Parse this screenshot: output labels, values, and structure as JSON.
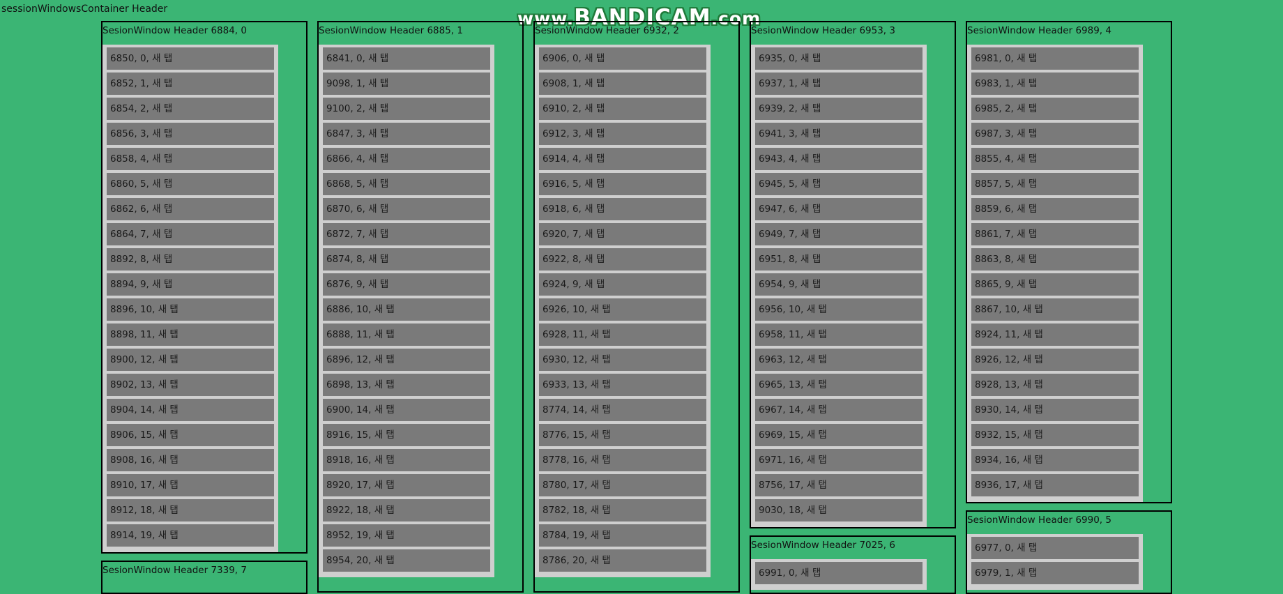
{
  "container": {
    "header": "sessionWindowsContainer Header"
  },
  "watermark": {
    "prefix": "www.",
    "brand": "BANDICAM",
    "suffix": ".com"
  },
  "windows": [
    {
      "header": "SesionWindow Header 6884, 0",
      "tabs": [
        "6850, 0, 새 탭",
        "6852, 1, 새 탭",
        "6854, 2, 새 탭",
        "6856, 3, 새 탭",
        "6858, 4, 새 탭",
        "6860, 5, 새 탭",
        "6862, 6, 새 탭",
        "6864, 7, 새 탭",
        "8892, 8, 새 탭",
        "8894, 9, 새 탭",
        "8896, 10, 새 탭",
        "8898, 11, 새 탭",
        "8900, 12, 새 탭",
        "8902, 13, 새 탭",
        "8904, 14, 새 탭",
        "8906, 15, 새 탭",
        "8908, 16, 새 탭",
        "8910, 17, 새 탭",
        "8912, 18, 새 탭",
        "8914, 19, 새 탭"
      ]
    },
    {
      "header": "SesionWindow Header 6885, 1",
      "tabs": [
        "6841, 0, 새 탭",
        "9098, 1, 새 탭",
        "9100, 2, 새 탭",
        "6847, 3, 새 탭",
        "6866, 4, 새 탭",
        "6868, 5, 새 탭",
        "6870, 6, 새 탭",
        "6872, 7, 새 탭",
        "6874, 8, 새 탭",
        "6876, 9, 새 탭",
        "6886, 10, 새 탭",
        "6888, 11, 새 탭",
        "6896, 12, 새 탭",
        "6898, 13, 새 탭",
        "6900, 14, 새 탭",
        "8916, 15, 새 탭",
        "8918, 16, 새 탭",
        "8920, 17, 새 탭",
        "8922, 18, 새 탭",
        "8952, 19, 새 탭",
        "8954, 20, 새 탭"
      ]
    },
    {
      "header": "SesionWindow Header 6932, 2",
      "tabs": [
        "6906, 0, 새 탭",
        "6908, 1, 새 탭",
        "6910, 2, 새 탭",
        "6912, 3, 새 탭",
        "6914, 4, 새 탭",
        "6916, 5, 새 탭",
        "6918, 6, 새 탭",
        "6920, 7, 새 탭",
        "6922, 8, 새 탭",
        "6924, 9, 새 탭",
        "6926, 10, 새 탭",
        "6928, 11, 새 탭",
        "6930, 12, 새 탭",
        "6933, 13, 새 탭",
        "8774, 14, 새 탭",
        "8776, 15, 새 탭",
        "8778, 16, 새 탭",
        "8780, 17, 새 탭",
        "8782, 18, 새 탭",
        "8784, 19, 새 탭",
        "8786, 20, 새 탭"
      ]
    },
    {
      "header": "SesionWindow Header 6953, 3",
      "tabs": [
        "6935, 0, 새 탭",
        "6937, 1, 새 탭",
        "6939, 2, 새 탭",
        "6941, 3, 새 탭",
        "6943, 4, 새 탭",
        "6945, 5, 새 탭",
        "6947, 6, 새 탭",
        "6949, 7, 새 탭",
        "6951, 8, 새 탭",
        "6954, 9, 새 탭",
        "6956, 10, 새 탭",
        "6958, 11, 새 탭",
        "6963, 12, 새 탭",
        "6965, 13, 새 탭",
        "6967, 14, 새 탭",
        "6969, 15, 새 탭",
        "6971, 16, 새 탭",
        "8756, 17, 새 탭",
        "9030, 18, 새 탭"
      ]
    },
    {
      "header": "SesionWindow Header 6989, 4",
      "tabs": [
        "6981, 0, 새 탭",
        "6983, 1, 새 탭",
        "6985, 2, 새 탭",
        "6987, 3, 새 탭",
        "8855, 4, 새 탭",
        "8857, 5, 새 탭",
        "8859, 6, 새 탭",
        "8861, 7, 새 탭",
        "8863, 8, 새 탭",
        "8865, 9, 새 탭",
        "8867, 10, 새 탭",
        "8924, 11, 새 탭",
        "8926, 12, 새 탭",
        "8928, 13, 새 탭",
        "8930, 14, 새 탭",
        "8932, 15, 새 탭",
        "8934, 16, 새 탭",
        "8936, 17, 새 탭"
      ]
    },
    {
      "header": "SesionWindow Header 6990, 5",
      "tabs": [
        "6977, 0, 새 탭",
        "6979, 1, 새 탭"
      ]
    },
    {
      "header": "SesionWindow Header 7025, 6",
      "tabs": [
        "6991, 0, 새 탭"
      ]
    },
    {
      "header": "SesionWindow Header 7339, 7",
      "tabs": []
    }
  ]
}
